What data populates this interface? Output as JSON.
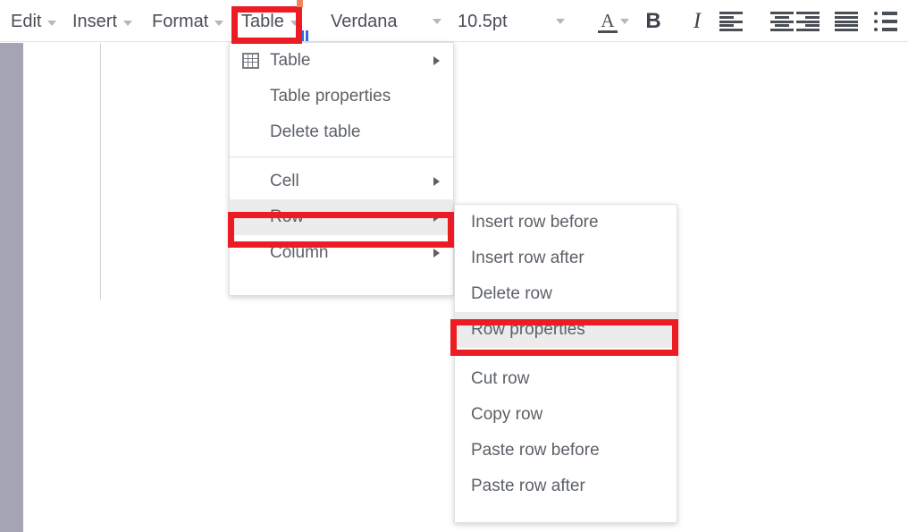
{
  "toolbar": {
    "menus": [
      {
        "label": "Edit",
        "icon": "chevron-down-icon"
      },
      {
        "label": "Insert",
        "icon": "chevron-down-icon"
      },
      {
        "label": "Format",
        "icon": "chevron-down-icon"
      },
      {
        "label": "Table",
        "icon": "chevron-down-icon"
      }
    ],
    "font_family": "Verdana",
    "font_size": "10.5pt",
    "font_color_glyph": "A",
    "bold_label": "B",
    "italic_label": "I",
    "icons": [
      "align-left-icon",
      "align-center-icon",
      "align-right-icon",
      "align-justify-icon",
      "bulleted-list-icon"
    ]
  },
  "table_menu": {
    "items": [
      {
        "label": "Table",
        "icon": "table-grid-icon",
        "submenu": true,
        "highlighted": false
      },
      {
        "label": "Table properties",
        "icon": "",
        "submenu": false,
        "highlighted": false
      },
      {
        "label": "Delete table",
        "icon": "",
        "submenu": false,
        "highlighted": false
      },
      {
        "label": "Cell",
        "icon": "",
        "submenu": true,
        "highlighted": false
      },
      {
        "label": "Row",
        "icon": "",
        "submenu": true,
        "highlighted": true
      },
      {
        "label": "Column",
        "icon": "",
        "submenu": true,
        "highlighted": false
      }
    ]
  },
  "row_submenu": {
    "items": [
      {
        "label": "Insert row before",
        "highlighted": false
      },
      {
        "label": "Insert row after",
        "highlighted": false
      },
      {
        "label": "Delete row",
        "highlighted": false
      },
      {
        "label": "Row properties",
        "highlighted": true
      },
      {
        "label": "Cut row",
        "highlighted": false
      },
      {
        "label": "Copy row",
        "highlighted": false
      },
      {
        "label": "Paste row before",
        "highlighted": false
      },
      {
        "label": "Paste row after",
        "highlighted": false
      }
    ]
  },
  "annotations": {
    "color": "#ec1c24",
    "targets": [
      "Table",
      "Row",
      "Row properties"
    ]
  },
  "colors": {
    "text": "#5c6168",
    "menu_highlight": "#ececec",
    "left_rail": "#a4a4b4",
    "annotation_red": "#ec1c24",
    "marker_blue": "#2f6ee0"
  }
}
